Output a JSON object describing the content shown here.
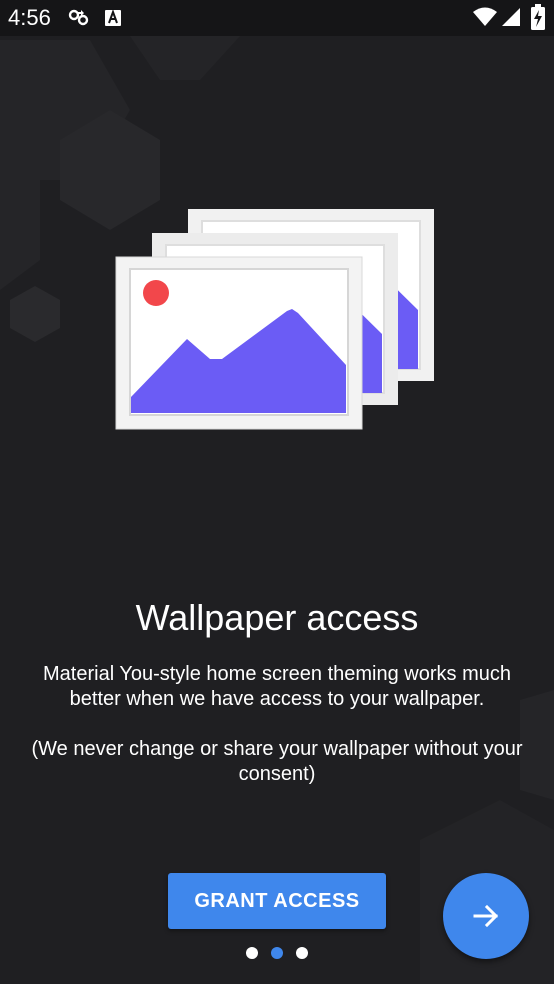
{
  "status_bar": {
    "time": "4:56",
    "icons": [
      "recycle-icon",
      "keyboard-a-icon",
      "wifi-icon",
      "signal-icon",
      "battery-charging-icon"
    ]
  },
  "onboarding": {
    "illustration": "wallpaper-stack-illustration",
    "title": "Wallpaper access",
    "description": "Material You-style home screen theming works much better when we have access to your wallpaper.",
    "note": "(We never change or share your wallpaper without your consent)",
    "grant_button_label": "GRANT ACCESS",
    "next_button_icon": "arrow-right-icon",
    "page_indicator": {
      "total_pages": 3,
      "current_page": 2
    }
  },
  "colors": {
    "background": "#1f1f22",
    "accent": "#3f87ec",
    "illustration_mountain": "#6b5cf5",
    "illustration_sun": "#f2474b",
    "dot_inactive": "#ffffff",
    "dot_active": "#3f87ec"
  }
}
